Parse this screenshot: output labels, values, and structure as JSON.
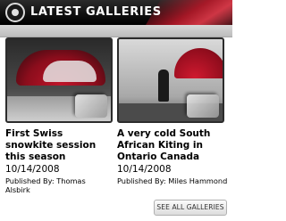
{
  "header": {
    "title": "LATEST GALLERIES",
    "icon": "circle-badge-icon",
    "accent_color": "#b41828"
  },
  "galleries": [
    {
      "title": "First Swiss snowkite session this season",
      "date": "10/14/2008",
      "published_by": "Published By: Thomas Alsbirk"
    },
    {
      "title": "A very cold South African Kiting in Ontario Canada",
      "date": "10/14/2008",
      "published_by": "Published By: Miles Hammond"
    }
  ],
  "footer": {
    "see_all_label": "SEE ALL GALLERIES"
  }
}
